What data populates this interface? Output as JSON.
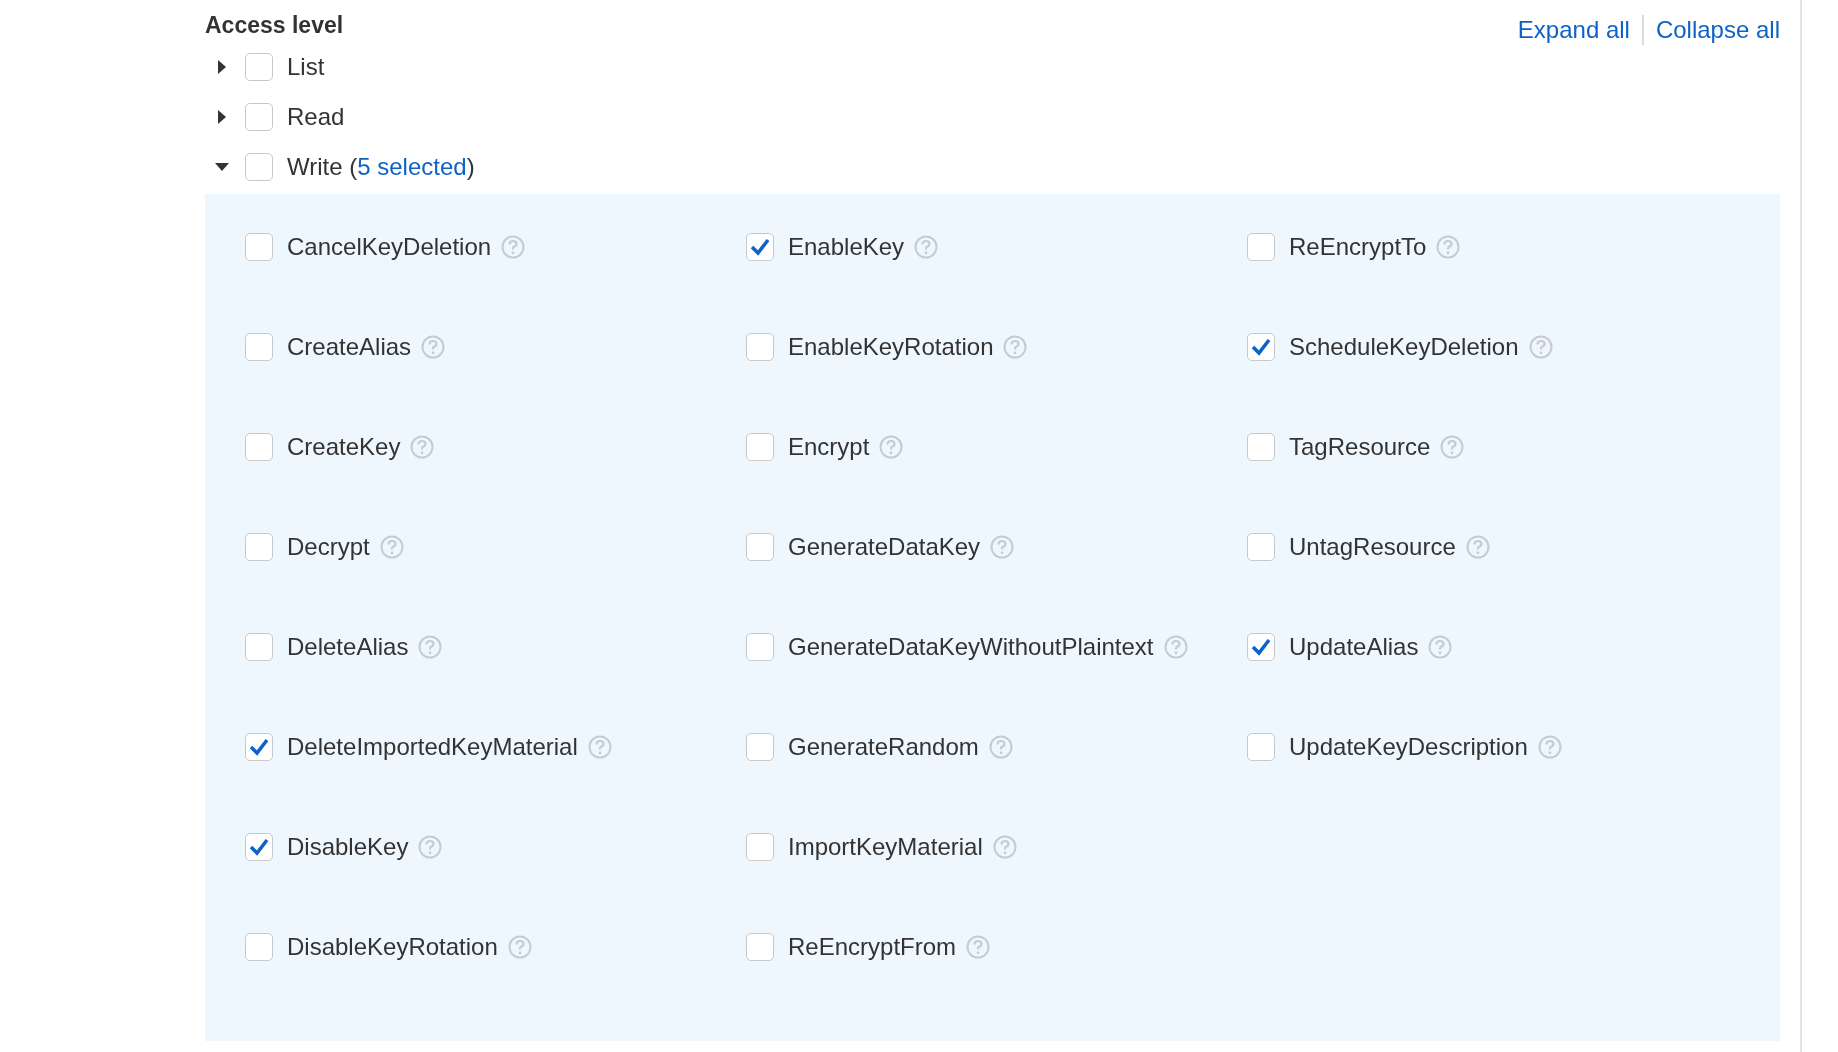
{
  "heading": "Access level",
  "links": [
    "Expand all",
    "Collapse all"
  ],
  "levels": [
    {
      "label": "List",
      "expanded": false,
      "checked": false
    },
    {
      "label": "Read",
      "expanded": false,
      "checked": false
    },
    {
      "label": "Write (",
      "expanded": true,
      "checked": false,
      "count": "5 selected",
      "count_suffix": ")",
      "actions": [
        {
          "name": "CancelKeyDeletion",
          "checked": false
        },
        {
          "name": "CreateAlias",
          "checked": false
        },
        {
          "name": "CreateKey",
          "checked": false
        },
        {
          "name": "Decrypt",
          "checked": false
        },
        {
          "name": "DeleteAlias",
          "checked": false
        },
        {
          "name": "DeleteImportedKeyMaterial",
          "checked": true
        },
        {
          "name": "DisableKey",
          "checked": true
        },
        {
          "name": "DisableKeyRotation",
          "checked": false
        },
        {
          "name": "EnableKey",
          "checked": true
        },
        {
          "name": "EnableKeyRotation",
          "checked": false
        },
        {
          "name": "Encrypt",
          "checked": false
        },
        {
          "name": "GenerateDataKey",
          "checked": false
        },
        {
          "name": "GenerateDataKeyWithoutPlaintext",
          "checked": false
        },
        {
          "name": "GenerateRandom",
          "checked": false
        },
        {
          "name": "ImportKeyMaterial",
          "checked": false
        },
        {
          "name": "ReEncryptFrom",
          "checked": false
        },
        {
          "name": "ReEncryptTo",
          "checked": false
        },
        {
          "name": "ScheduleKeyDeletion",
          "checked": true
        },
        {
          "name": "TagResource",
          "checked": false
        },
        {
          "name": "UntagResource",
          "checked": false
        },
        {
          "name": "UpdateAlias",
          "checked": true
        },
        {
          "name": "UpdateKeyDescription",
          "checked": false
        }
      ]
    }
  ]
}
